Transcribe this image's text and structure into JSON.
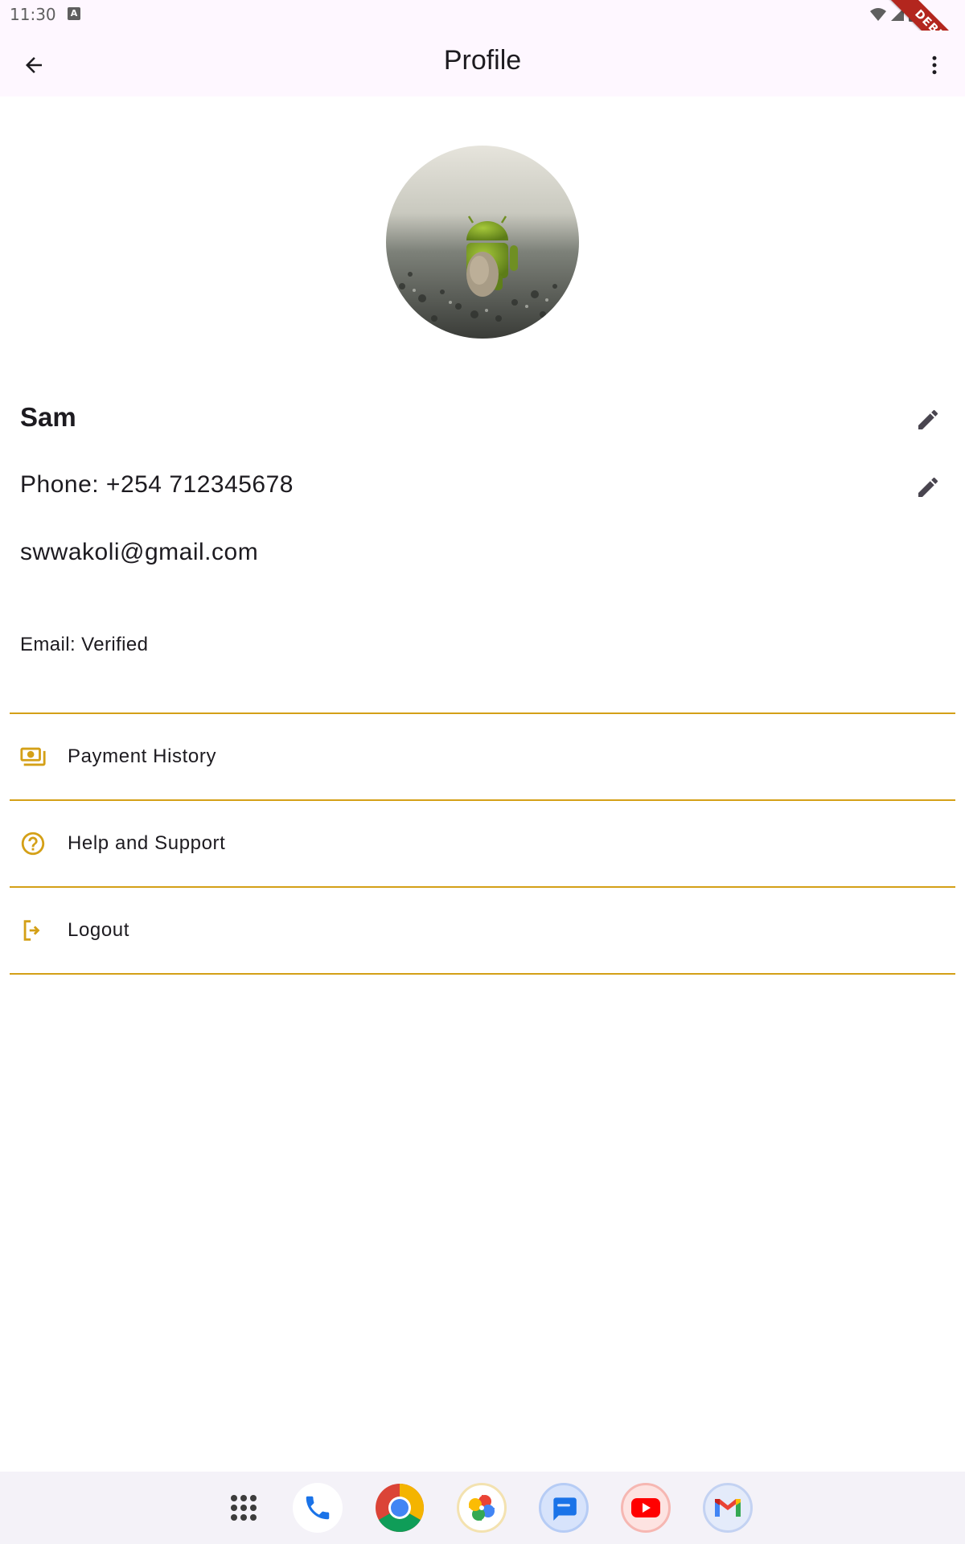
{
  "status_bar": {
    "time": "11:30",
    "notification_icon_letter": "A",
    "debug_label": "DEBUG"
  },
  "app_bar": {
    "title": "Profile",
    "back_icon": "arrow-back-icon",
    "menu_icon": "more-vert-icon"
  },
  "profile": {
    "name": "Sam",
    "phone": "Phone: +254 712345678",
    "email": "swwakoli@gmail.com",
    "email_status": "Email: Verified",
    "edit_icon": "pencil-icon"
  },
  "menu": {
    "accent_color": "#d4a017",
    "items": [
      {
        "label": "Payment History",
        "icon": "payments-icon"
      },
      {
        "label": "Help and Support",
        "icon": "help-circle-icon"
      },
      {
        "label": "Logout",
        "icon": "logout-icon"
      }
    ]
  },
  "dock": {
    "apps": [
      {
        "name": "App drawer",
        "icon": "apps-grid-icon"
      },
      {
        "name": "Phone",
        "icon": "phone-icon"
      },
      {
        "name": "Chrome",
        "icon": "chrome-icon"
      },
      {
        "name": "Photos",
        "icon": "photos-icon"
      },
      {
        "name": "Messages",
        "icon": "messages-icon"
      },
      {
        "name": "YouTube",
        "icon": "youtube-icon"
      },
      {
        "name": "Gmail",
        "icon": "gmail-icon"
      }
    ]
  }
}
